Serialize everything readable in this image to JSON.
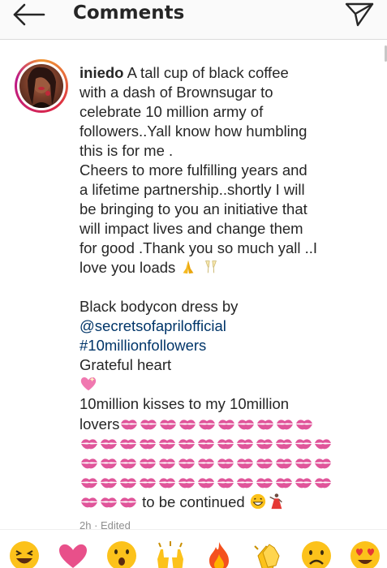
{
  "header": {
    "title": "Comments",
    "back_icon": "arrow-left-icon",
    "send_icon": "paper-plane-icon"
  },
  "comment": {
    "username": "iniedo",
    "lines": [
      " A tall cup of black coffee",
      "with a dash of Brownsugar to",
      "celebrate 10 million army of",
      "followers..Yall know how humbling",
      "this is for me .",
      "Cheers to more fulfilling years and",
      "a lifetime partnership..shortly I will",
      "be bringing to you an initiative that",
      "will impact lives and change them",
      "for good .Thank you so much yall ..I",
      "love you loads"
    ],
    "dress_line": "Black bodycon dress by",
    "mention": "@secretsofaprilofficial",
    "hashtag": "#10millionfollowers",
    "grateful": "Grateful heart",
    "kisses_line": "10million kisses to my 10million",
    "lovers": "lovers",
    "continued": " to be continued ",
    "timestamp": "2h · Edited"
  },
  "emoji_bar": [
    "laughing-face-icon",
    "pink-heart-icon",
    "surprised-face-icon",
    "raised-hands-icon",
    "fire-icon",
    "clapping-hands-icon",
    "frowning-face-icon",
    "heart-eyes-face-icon"
  ],
  "colors": {
    "text": "#262626",
    "link": "#003569",
    "muted": "#8e8e8e",
    "header_bg": "#fafafa",
    "divider": "#dbdbdb",
    "kiss": "#e0559a"
  }
}
